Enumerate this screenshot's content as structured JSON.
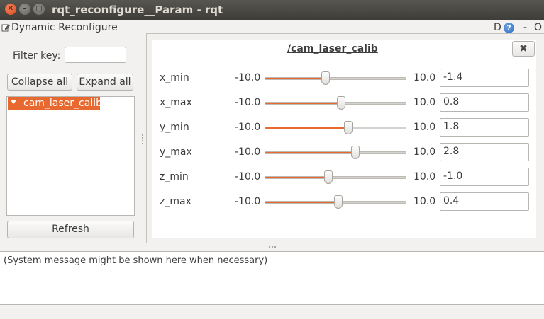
{
  "window": {
    "title": "rqt_reconfigure__Param - rqt",
    "controls": [
      "close-icon",
      "minimize-icon",
      "maximize-icon"
    ]
  },
  "plugin": {
    "title": "Dynamic Reconfigure",
    "header_d": "D",
    "header_help": "?",
    "header_dash": "-",
    "header_o": "O"
  },
  "left_panel": {
    "filter_label": "Filter key:",
    "filter_value": "",
    "collapse_label": "Collapse all",
    "expand_label": "Expand all",
    "tree_items": [
      {
        "label": "cam_laser_calib",
        "selected": true
      }
    ],
    "refresh_label": "Refresh"
  },
  "group": {
    "title": "/cam_laser_calib",
    "close_icon": "close-icon"
  },
  "params": [
    {
      "name": "x_min",
      "min_label": "-10.0",
      "max_label": "10.0",
      "value": "-1.4",
      "min": -10.0,
      "max": 10.0,
      "current": -1.4
    },
    {
      "name": "x_max",
      "min_label": "-10.0",
      "max_label": "10.0",
      "value": "0.8",
      "min": -10.0,
      "max": 10.0,
      "current": 0.8
    },
    {
      "name": "y_min",
      "min_label": "-10.0",
      "max_label": "10.0",
      "value": "1.8",
      "min": -10.0,
      "max": 10.0,
      "current": 1.8
    },
    {
      "name": "y_max",
      "min_label": "-10.0",
      "max_label": "10.0",
      "value": "2.8",
      "min": -10.0,
      "max": 10.0,
      "current": 2.8
    },
    {
      "name": "z_min",
      "min_label": "-10.0",
      "max_label": "10.0",
      "value": "-1.0",
      "min": -10.0,
      "max": 10.0,
      "current": -1.0
    },
    {
      "name": "z_max",
      "min_label": "-10.0",
      "max_label": "10.0",
      "value": "0.4",
      "min": -10.0,
      "max": 10.0,
      "current": 0.4
    }
  ],
  "status": {
    "message": "(System message might be shown here when necessary)"
  },
  "colors": {
    "accent": "#e8692f",
    "titlebar": "#3e3d39"
  }
}
